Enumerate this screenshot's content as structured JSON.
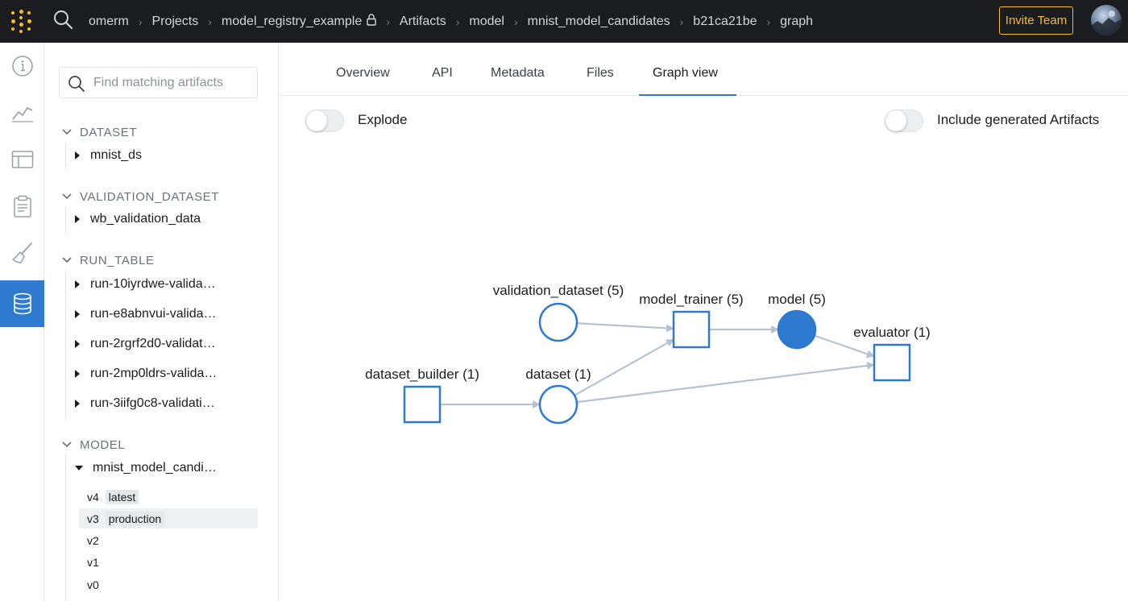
{
  "topbar": {
    "breadcrumbs": [
      "omerm",
      "Projects",
      "model_registry_example",
      "Artifacts",
      "model",
      "mnist_model_candidates",
      "b21ca21be",
      "graph"
    ],
    "invite_label": "Invite Team",
    "colors": {
      "bar": "#1a1c1f",
      "accent": "#f5be2c"
    }
  },
  "rail": {
    "icons": [
      "info-icon",
      "chart-icon",
      "table-icon",
      "clipboard-icon",
      "broom-icon",
      "database-icon"
    ],
    "active": "database-icon"
  },
  "sidebar": {
    "search_placeholder": "Find matching artifacts",
    "groups": [
      {
        "name": "DATASET",
        "items": [
          "mnist_ds"
        ]
      },
      {
        "name": "VALIDATION_DATASET",
        "items": [
          "wb_validation_data"
        ]
      },
      {
        "name": "RUN_TABLE",
        "items": [
          "run-10iyrdwe-valida…",
          "run-e8abnvui-valida…",
          "run-2rgrf2d0-validat…",
          "run-2mp0ldrs-valida…",
          "run-3iifg0c8-validati…"
        ]
      },
      {
        "name": "MODEL",
        "items": [
          "mnist_model_candi…"
        ]
      }
    ],
    "versions": [
      {
        "label": "v4",
        "tag": "latest"
      },
      {
        "label": "v3",
        "tag": "production"
      },
      {
        "label": "v2",
        "tag": ""
      },
      {
        "label": "v1",
        "tag": ""
      },
      {
        "label": "v0",
        "tag": ""
      }
    ]
  },
  "tabs": [
    "Overview",
    "API",
    "Metadata",
    "Files",
    "Graph view"
  ],
  "active_tab": "Graph view",
  "toggles": {
    "explode_label": "Explode",
    "explode_on": false,
    "generated_label": "Include generated Artifacts",
    "generated_on": false
  },
  "graph": {
    "nodes": [
      {
        "id": "dataset_builder",
        "label": "dataset_builder (1)",
        "kind": "run"
      },
      {
        "id": "dataset",
        "label": "dataset (1)",
        "kind": "artifact"
      },
      {
        "id": "validation_dataset",
        "label": "validation_dataset (5)",
        "kind": "artifact"
      },
      {
        "id": "model_trainer",
        "label": "model_trainer (5)",
        "kind": "run"
      },
      {
        "id": "model",
        "label": "model (5)",
        "kind": "artifact",
        "selected": true
      },
      {
        "id": "evaluator",
        "label": "evaluator (1)",
        "kind": "run"
      }
    ],
    "edges": [
      [
        "dataset_builder",
        "dataset"
      ],
      [
        "dataset",
        "model_trainer"
      ],
      [
        "dataset",
        "evaluator"
      ],
      [
        "validation_dataset",
        "model_trainer"
      ],
      [
        "model_trainer",
        "model"
      ],
      [
        "model",
        "evaluator"
      ]
    ],
    "colors": {
      "node": "#2f7ad1",
      "edge": "#b6c2cf"
    }
  }
}
